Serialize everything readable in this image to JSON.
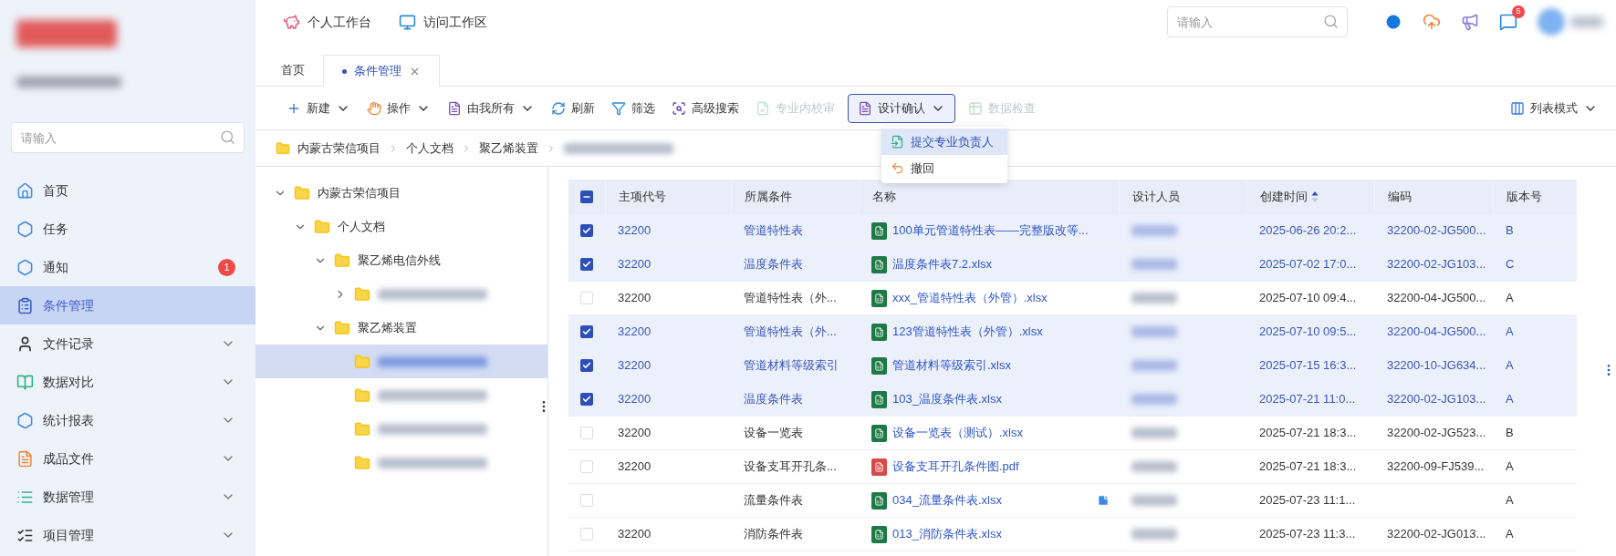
{
  "top_nav": {
    "links": [
      {
        "label": "个人工作台"
      },
      {
        "label": "访问工作区"
      }
    ],
    "search": {
      "placeholder": "请输入"
    },
    "message_badge": "5"
  },
  "sidebar": {
    "search": {
      "placeholder": "请输入"
    },
    "items": [
      {
        "label": "首页",
        "selected": false,
        "expandable": false
      },
      {
        "label": "任务",
        "selected": false,
        "expandable": false
      },
      {
        "label": "通知",
        "selected": false,
        "expandable": false,
        "badge": "1"
      },
      {
        "label": "条件管理",
        "selected": true,
        "expandable": false
      },
      {
        "label": "文件记录",
        "selected": false,
        "expandable": true
      },
      {
        "label": "数据对比",
        "selected": false,
        "expandable": true
      },
      {
        "label": "统计报表",
        "selected": false,
        "expandable": true
      },
      {
        "label": "成品文件",
        "selected": false,
        "expandable": true
      },
      {
        "label": "数据管理",
        "selected": false,
        "expandable": true
      },
      {
        "label": "项目管理",
        "selected": false,
        "expandable": true
      }
    ]
  },
  "tabs": [
    {
      "label": "首页",
      "selected": false,
      "closable": false
    },
    {
      "label": "条件管理",
      "selected": true,
      "closable": true
    }
  ],
  "toolbar": {
    "buttons": [
      {
        "label": "新建",
        "dropdown": true,
        "disabled": false,
        "open": false
      },
      {
        "label": "操作",
        "dropdown": true,
        "disabled": false,
        "open": false
      },
      {
        "label": "由我所有",
        "dropdown": true,
        "disabled": false,
        "open": false
      },
      {
        "label": "刷新",
        "dropdown": false,
        "disabled": false,
        "open": false
      },
      {
        "label": "筛选",
        "dropdown": false,
        "disabled": false,
        "open": false
      },
      {
        "label": "高级搜索",
        "dropdown": false,
        "disabled": false,
        "open": false
      },
      {
        "label": "专业内校审",
        "dropdown": false,
        "disabled": true,
        "open": false
      },
      {
        "label": "设计确认",
        "dropdown": true,
        "disabled": false,
        "open": true
      },
      {
        "label": "数据检查",
        "dropdown": false,
        "disabled": true,
        "open": false
      }
    ],
    "view_mode": "列表模式"
  },
  "menu": {
    "items": [
      {
        "label": "提交专业负责人",
        "selected": true
      },
      {
        "label": "撤回",
        "selected": false
      }
    ]
  },
  "breadcrumb": [
    {
      "label": "内蒙古荣信项目",
      "redacted": false
    },
    {
      "label": "个人文档",
      "redacted": false
    },
    {
      "label": "聚乙烯装置",
      "redacted": false
    },
    {
      "redacted": true
    }
  ],
  "tree": [
    {
      "label": "内蒙古荣信项目",
      "redacted": false,
      "expanded": true,
      "selected": false,
      "children": [
        {
          "label": "个人文档",
          "redacted": false,
          "expanded": true,
          "selected": false,
          "children": [
            {
              "label": "聚乙烯电信外线",
              "redacted": false,
              "expanded": true,
              "selected": false,
              "children": [
                {
                  "redacted": true,
                  "expanded": false,
                  "selected": false,
                  "expandable": true
                }
              ]
            },
            {
              "label": "聚乙烯装置",
              "redacted": false,
              "expanded": true,
              "selected": false,
              "children": [
                {
                  "redacted": true,
                  "expanded": false,
                  "selected": true,
                  "expandable": false
                },
                {
                  "redacted": true,
                  "expanded": false,
                  "selected": false,
                  "expandable": false
                },
                {
                  "redacted": true,
                  "expanded": false,
                  "selected": false,
                  "expandable": false
                },
                {
                  "redacted": true,
                  "expanded": false,
                  "selected": false,
                  "expandable": false
                }
              ]
            }
          ]
        }
      ]
    }
  ],
  "table": {
    "select_all": {
      "checked": true,
      "indeterminate": true
    },
    "columns": [
      {
        "label": "主项代号",
        "sorted": false
      },
      {
        "label": "所属条件",
        "sorted": false
      },
      {
        "label": "名称",
        "sorted": false
      },
      {
        "label": "设计人员",
        "sorted": false
      },
      {
        "label": "创建时间",
        "sorted": true
      },
      {
        "label": "编码",
        "sorted": false
      },
      {
        "label": "版本号",
        "sorted": false
      }
    ],
    "rows": [
      {
        "selected": true,
        "code": "32200",
        "condition": "管道特性表",
        "kind": "spreadsheet",
        "name": "100单元管道特性表——完整版改等...",
        "note": false,
        "created": "2025-06-26 20:2...",
        "number": "32200-02-JG500...",
        "version": "B"
      },
      {
        "selected": true,
        "code": "32200",
        "condition": "温度条件表",
        "kind": "spreadsheet",
        "name": "温度条件表7.2.xlsx",
        "note": false,
        "created": "2025-07-02 17:0...",
        "number": "32200-02-JG103...",
        "version": "C"
      },
      {
        "selected": false,
        "code": "32200",
        "condition": "管道特性表（外...",
        "kind": "spreadsheet",
        "name": "xxx_管道特性表（外管）.xlsx",
        "note": false,
        "created": "2025-07-10 09:4...",
        "number": "32200-04-JG500...",
        "version": "A"
      },
      {
        "selected": true,
        "code": "32200",
        "condition": "管道特性表（外...",
        "kind": "spreadsheet",
        "name": "123管道特性表（外管）.xlsx",
        "note": false,
        "created": "2025-07-10 09:5...",
        "number": "32200-04-JG500...",
        "version": "A"
      },
      {
        "selected": true,
        "code": "32200",
        "condition": "管道材料等级索引",
        "kind": "spreadsheet",
        "name": "管道材料等级索引.xlsx",
        "note": false,
        "created": "2025-07-15 16:3...",
        "number": "32200-10-JG634...",
        "version": "A"
      },
      {
        "selected": true,
        "code": "32200",
        "condition": "温度条件表",
        "kind": "spreadsheet",
        "name": "103_温度条件表.xlsx",
        "note": false,
        "created": "2025-07-21 11:0...",
        "number": "32200-02-JG103...",
        "version": "A"
      },
      {
        "selected": false,
        "code": "32200",
        "condition": "设备一览表",
        "kind": "spreadsheet",
        "name": "设备一览表（测试）.xlsx",
        "note": false,
        "created": "2025-07-21 18:3...",
        "number": "32200-02-JG523...",
        "version": "B"
      },
      {
        "selected": false,
        "code": "32200",
        "condition": "设备支耳开孔条...",
        "kind": "pdf",
        "name": "设备支耳开孔条件图.pdf",
        "note": false,
        "created": "2025-07-21 18:3...",
        "number": "32200-09-FJ539...",
        "version": "A"
      },
      {
        "selected": false,
        "condition": "流量条件表",
        "kind": "spreadsheet",
        "name": "034_流量条件表.xlsx",
        "note": true,
        "created": "2025-07-23 11:1...",
        "version": "A"
      },
      {
        "selected": false,
        "code": "32200",
        "condition": "消防条件表",
        "kind": "spreadsheet",
        "name": "013_消防条件表.xlsx",
        "note": false,
        "created": "2025-07-23 11:3...",
        "number": "32200-02-JG013...",
        "version": "A"
      }
    ]
  }
}
